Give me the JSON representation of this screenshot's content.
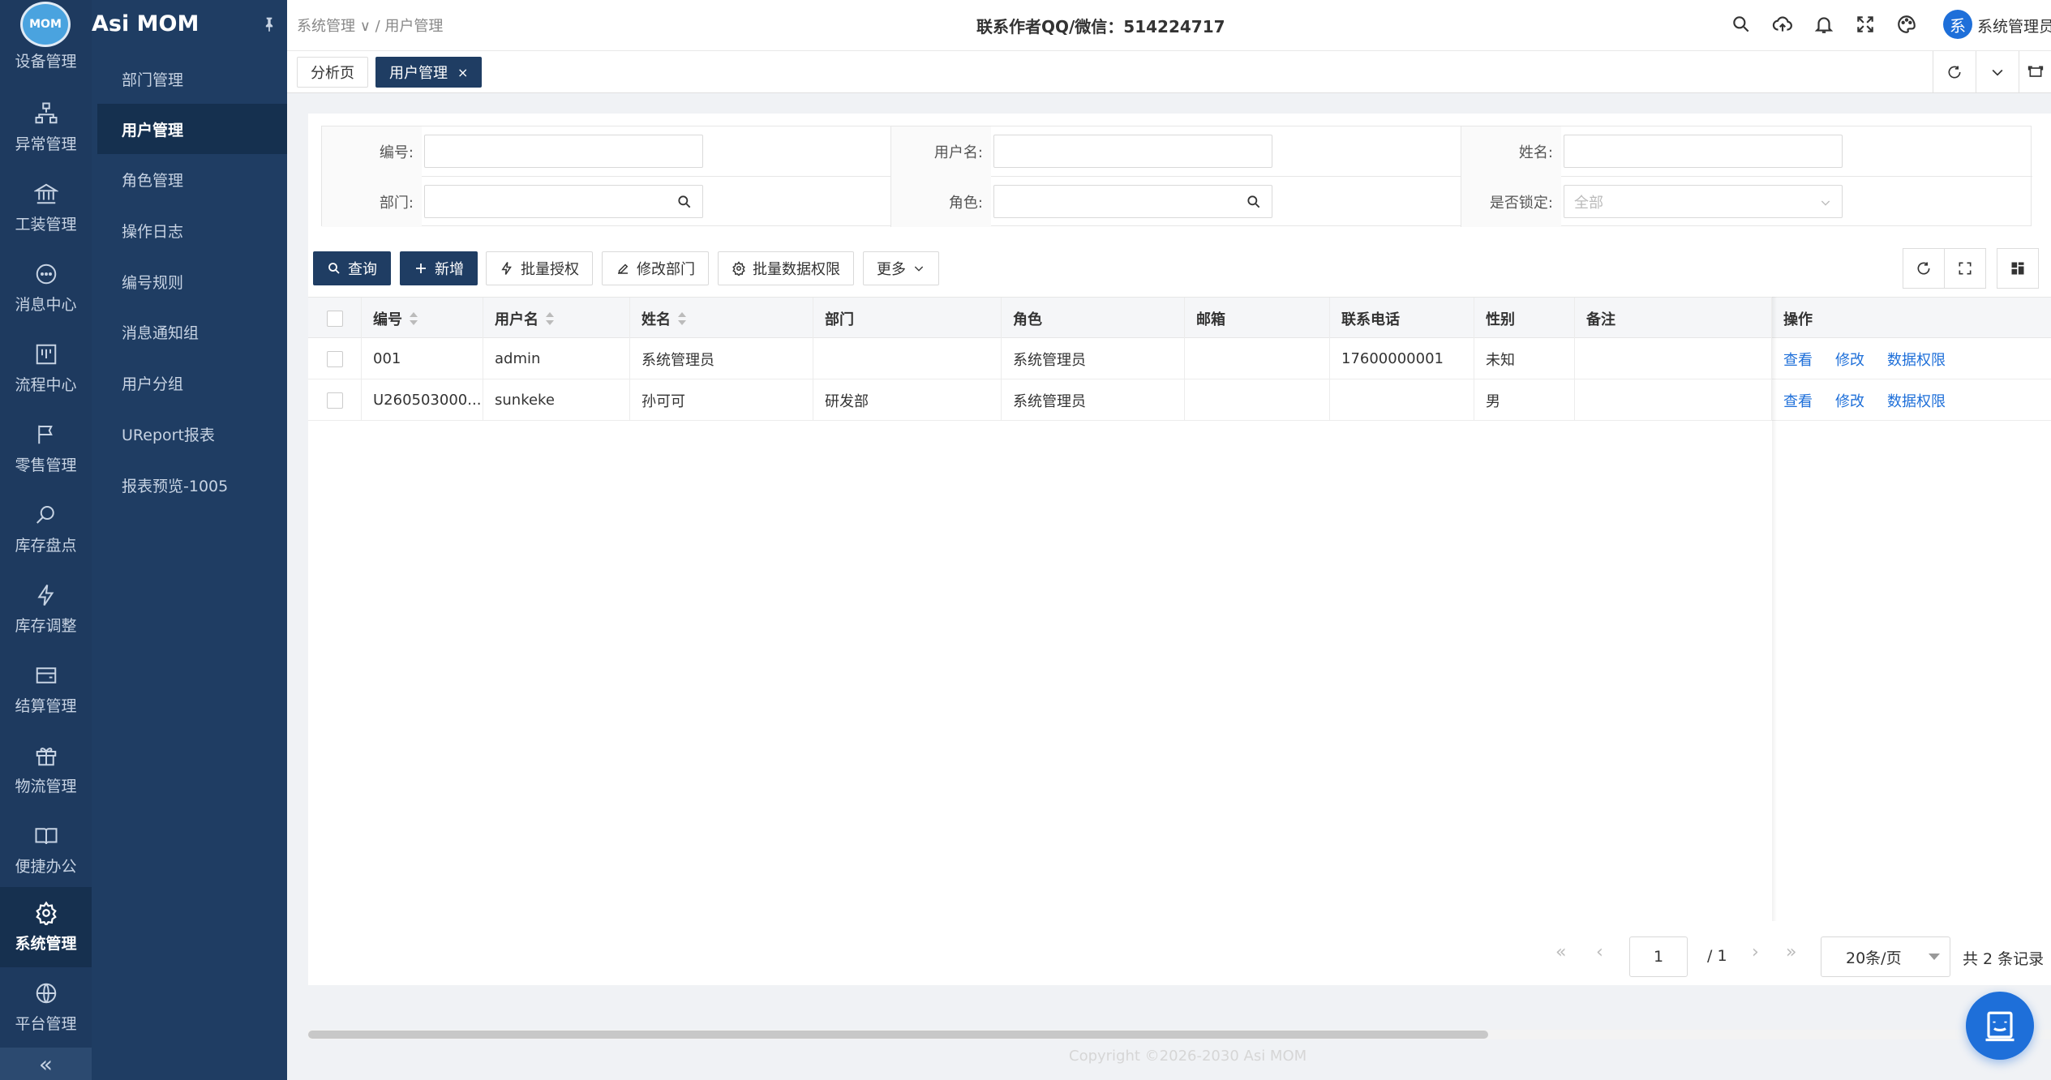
{
  "app": {
    "logo_text": "MOM",
    "name": "Asi MOM"
  },
  "rail": {
    "items": [
      {
        "label": "设备管理"
      },
      {
        "label": "异常管理"
      },
      {
        "label": "工装管理"
      },
      {
        "label": "消息中心"
      },
      {
        "label": "流程中心"
      },
      {
        "label": "零售管理"
      },
      {
        "label": "库存盘点"
      },
      {
        "label": "库存调整"
      },
      {
        "label": "结算管理"
      },
      {
        "label": "物流管理"
      },
      {
        "label": "便捷办公"
      },
      {
        "label": "系统管理"
      },
      {
        "label": "平台管理"
      }
    ],
    "collapse": "«"
  },
  "submenu": {
    "items": [
      {
        "label": "部门管理"
      },
      {
        "label": "用户管理"
      },
      {
        "label": "角色管理"
      },
      {
        "label": "操作日志"
      },
      {
        "label": "编号规则"
      },
      {
        "label": "消息通知组"
      },
      {
        "label": "用户分组"
      },
      {
        "label": "UReport报表"
      },
      {
        "label": "报表预览-1005"
      }
    ]
  },
  "header": {
    "breadcrumb": "系统管理 ∨ / 用户管理",
    "contact": "联系作者QQ/微信：514224717",
    "avatar_char": "系",
    "username": "系统管理员"
  },
  "tabs": [
    {
      "label": "分析页"
    },
    {
      "label": "用户管理",
      "close": "×"
    }
  ],
  "filter": {
    "code_label": "编号:",
    "username_label": "用户名:",
    "name_label": "姓名:",
    "dept_label": "部门:",
    "role_label": "角色:",
    "locked_label": "是否锁定:",
    "locked_value": "全部"
  },
  "toolbar": {
    "query": "查询",
    "add": "新增",
    "batch_auth": "批量授权",
    "change_dept": "修改部门",
    "batch_data_perm": "批量数据权限",
    "more": "更多"
  },
  "table": {
    "columns": [
      "编号",
      "用户名",
      "姓名",
      "部门",
      "角色",
      "邮箱",
      "联系电话",
      "性别",
      "备注",
      "操作"
    ],
    "rows": [
      {
        "code": "001",
        "username": "admin",
        "name": "系统管理员",
        "dept": "",
        "role": "系统管理员",
        "email": "",
        "phone": "17600000001",
        "gender": "未知",
        "remark": ""
      },
      {
        "code": "U260503000...",
        "username": "sunkeke",
        "name": "孙可可",
        "dept": "研发部",
        "role": "系统管理员",
        "email": "",
        "phone": "",
        "gender": "男",
        "remark": ""
      }
    ],
    "actions": {
      "view": "查看",
      "edit": "修改",
      "data_perm": "数据权限"
    }
  },
  "pager": {
    "page": "1",
    "total_pages": "/ 1",
    "page_size": "20条/页",
    "total": "共 2 条记录"
  },
  "footer": {
    "copyright": "Copyright ©2026-2030 Asi MOM"
  }
}
